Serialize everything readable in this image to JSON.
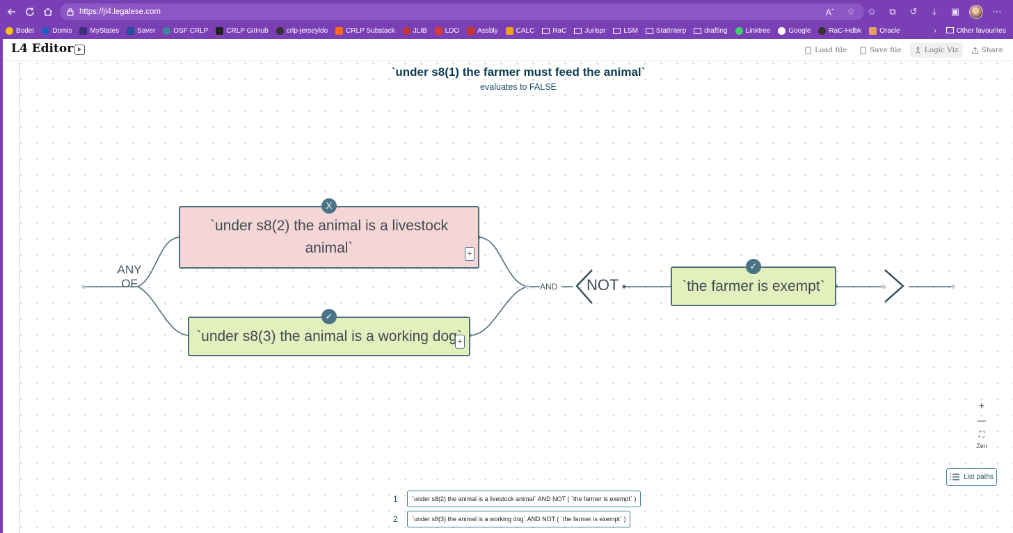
{
  "browser": {
    "url": "https://jl4.legalese.com",
    "bookmarks": [
      "Bodet",
      "Domis",
      "MyStates",
      "Saver",
      "OSF CRLP",
      "CRLP GitHub",
      "crlp-jerseyldo",
      "CRLP Substack",
      "JLIB",
      "LDO",
      "Assbly",
      "CALC",
      "RaC",
      "Jurispr",
      "LSM",
      "StatInterp",
      "drafting",
      "Linktree",
      "Google",
      "RaC-Hdbk",
      "Oracle"
    ],
    "other_favourites": "Other favourites",
    "accent": "#7b3fb5"
  },
  "app": {
    "title": "L4 Editor",
    "actions": {
      "load": "Load file",
      "save": "Save file",
      "logic": "Logic Viz",
      "share": "Share"
    }
  },
  "viz": {
    "title": "`under s8(1) the farmer must feed the animal`",
    "subtitle": "evaluates to FALSE",
    "any_of": "ANY OF",
    "and": "AND",
    "not": "NOT",
    "nodes": {
      "livestock": {
        "text": "`under s8(2) the animal is a livestock animal`",
        "badge": "X",
        "value": false
      },
      "dog": {
        "text": "`under s8(3) the animal is a working dog`",
        "badge": "✓",
        "value": true
      },
      "exempt": {
        "text": "`the farmer is exempt`",
        "badge": "✓",
        "value": true
      }
    },
    "plus": "+",
    "colors": {
      "false_fill": "#f5d6d6",
      "true_fill": "#e2f0bd",
      "edge": "#4e6d7a"
    }
  },
  "controls": {
    "zoom_in": "+",
    "zoom_out": "—",
    "fit": "⛶",
    "zen": "Zen",
    "list_paths": "List paths"
  },
  "paths": [
    {
      "num": "1",
      "text": "`under s8(2) the animal is a livestock animal` AND NOT ( `the farmer is exempt` )"
    },
    {
      "num": "2",
      "text": "`under s8(3) the animal is a working dog` AND NOT ( `the farmer is exempt` )"
    }
  ]
}
